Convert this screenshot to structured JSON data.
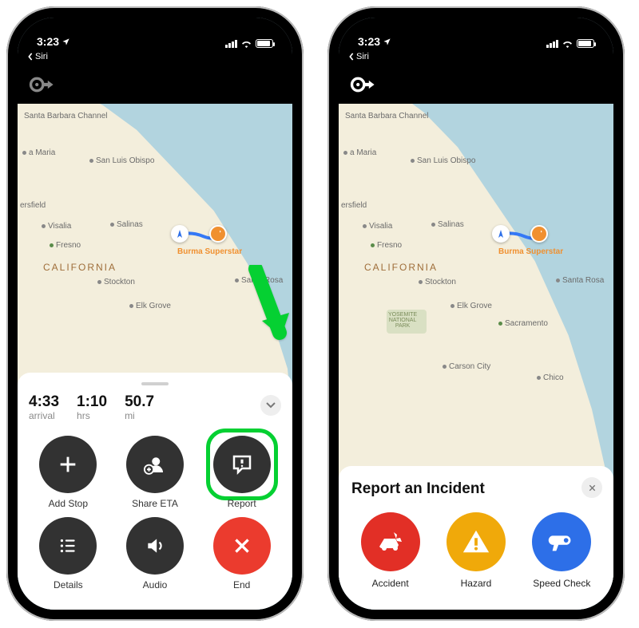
{
  "status": {
    "time": "3:23",
    "back_label": "Siri"
  },
  "map": {
    "region_label": "CALIFORNIA",
    "destination_label": "Burma Superstar",
    "cities": [
      "Santa Barbara Channel",
      "a Maria",
      "San Luis Obispo",
      "ersfield",
      "Visalia",
      "Salinas",
      "Fresno",
      "Stockton",
      "Elk Grove",
      "Santa Rosa",
      "Sacramento",
      "Carson City",
      "Chico"
    ],
    "park_label": "YOSEMITE\nNATIONAL\nPARK"
  },
  "trip": {
    "arrival_value": "4:33",
    "arrival_label": "arrival",
    "duration_value": "1:10",
    "duration_label": "hrs",
    "distance_value": "50.7",
    "distance_label": "mi"
  },
  "actions": {
    "add_stop": "Add Stop",
    "share_eta": "Share ETA",
    "report": "Report",
    "details": "Details",
    "audio": "Audio",
    "end": "End"
  },
  "incident_sheet": {
    "title": "Report an Incident",
    "accident": "Accident",
    "hazard": "Hazard",
    "speed_check": "Speed Check"
  }
}
